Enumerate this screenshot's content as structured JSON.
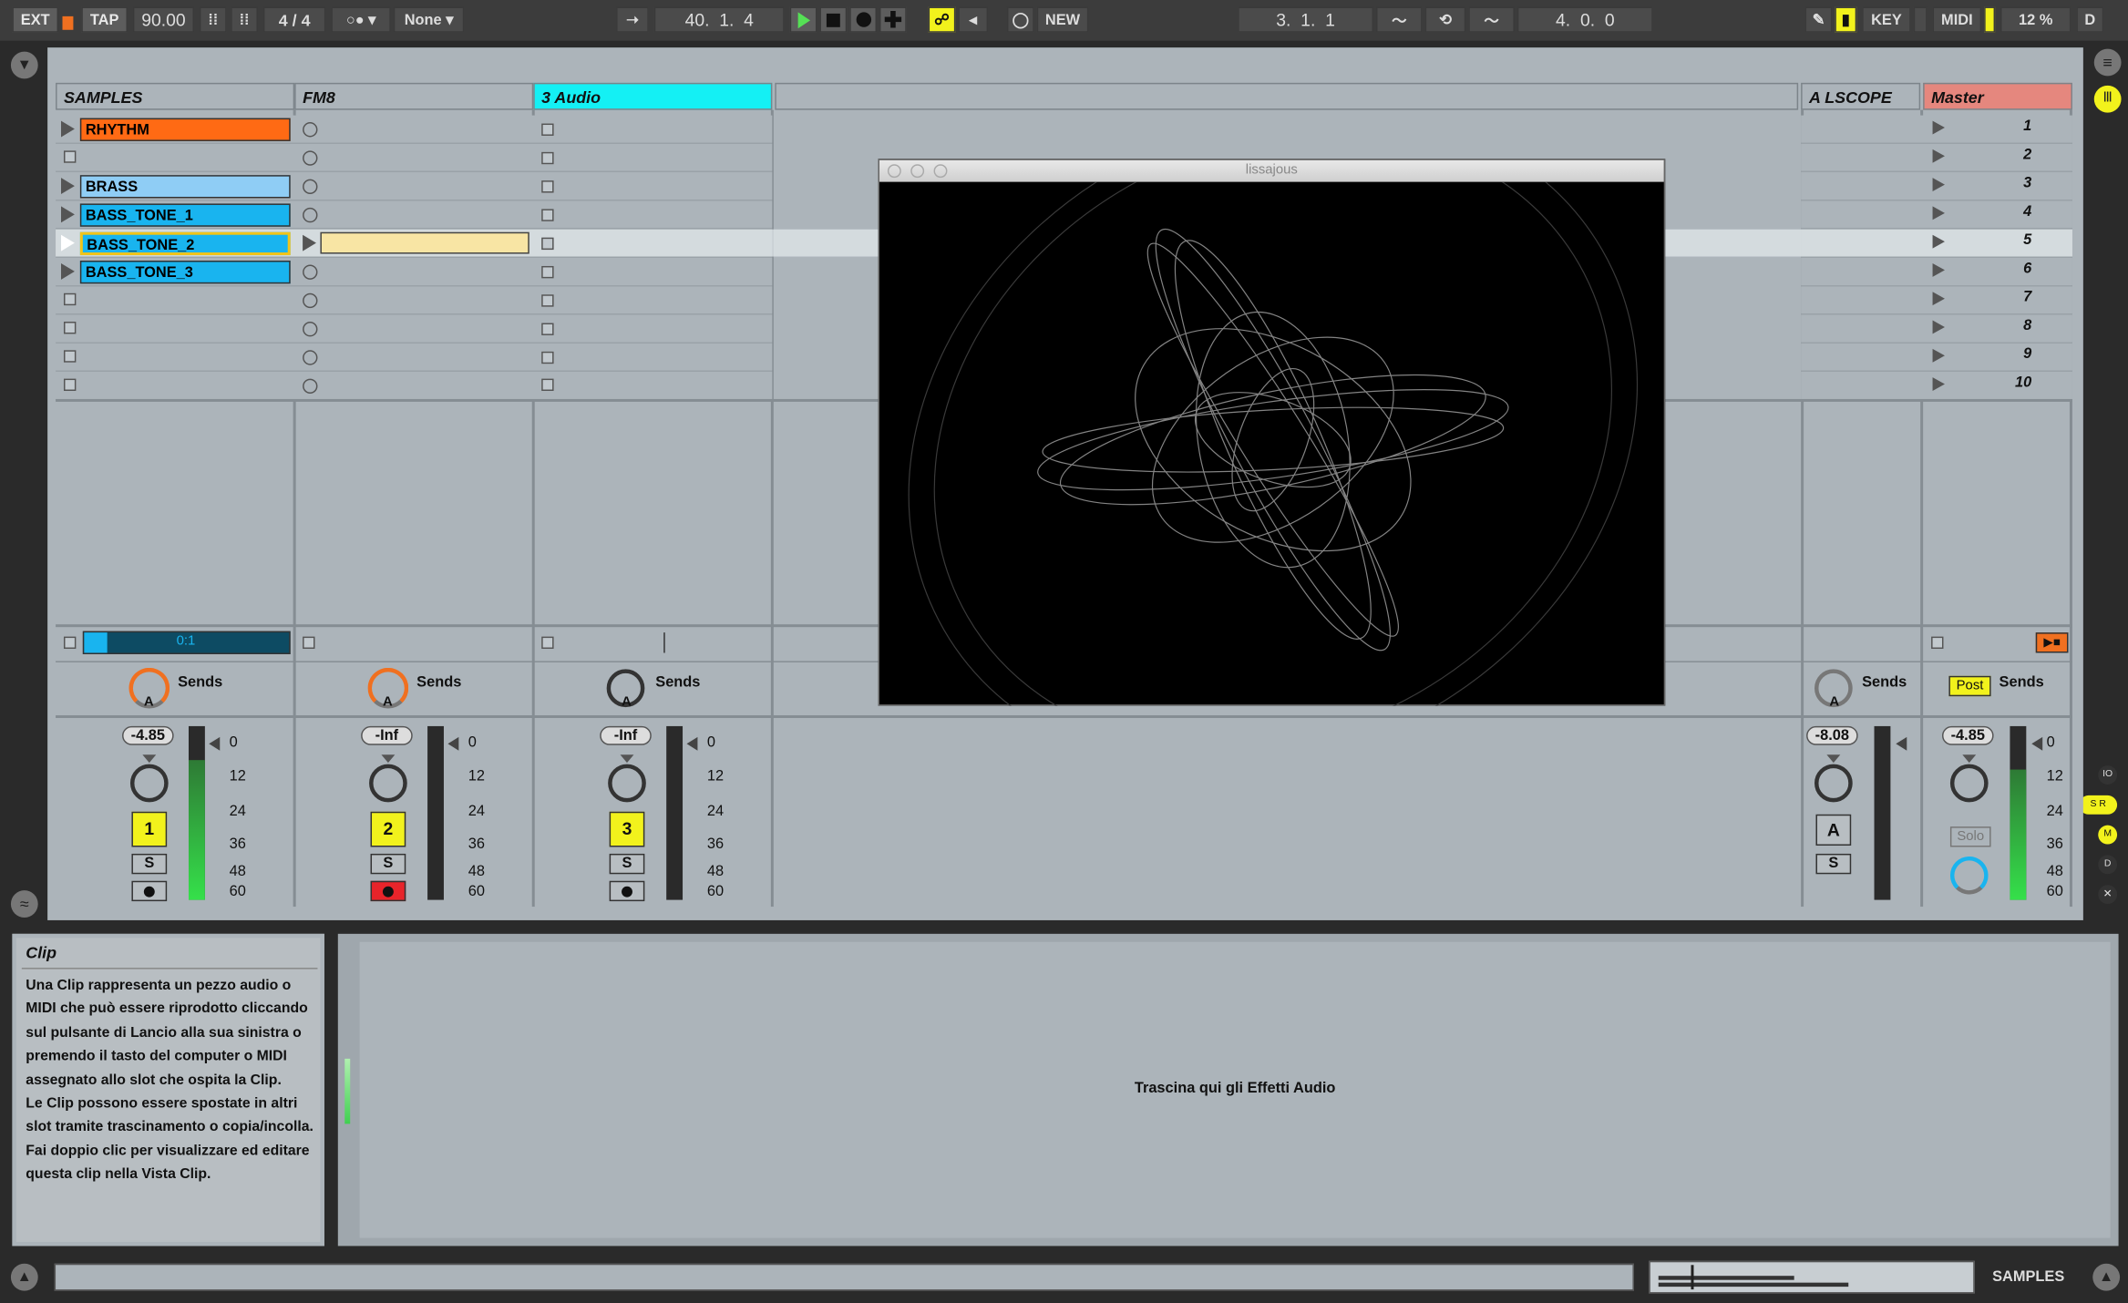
{
  "toolbar": {
    "ext": "EXT",
    "tap": "TAP",
    "bpm": "90.00",
    "meter_num": "4",
    "meter_den": "4",
    "quant": "None",
    "position": "40.  1.  4",
    "new": "NEW",
    "loop_start": "3.  1.  1",
    "loop_len": "4.  0.  0",
    "key": "KEY",
    "midi": "MIDI",
    "cpu": "12 %",
    "d": "D"
  },
  "tracks": [
    {
      "name": "SAMPLES",
      "color": "#acb4ba",
      "clips": [
        "RHYTHM",
        "",
        "BRASS",
        "BASS_TONE_1",
        "BASS_TONE_2",
        "BASS_TONE_3"
      ],
      "volume": "-4.85",
      "number": "1"
    },
    {
      "name": "FM8",
      "color": "#acb4ba",
      "volume": "-Inf",
      "number": "2"
    },
    {
      "name": "3 Audio",
      "color": "#14f0f4",
      "volume": "-Inf",
      "number": "3"
    }
  ],
  "return_track": {
    "name": "A LSCOPE",
    "volume": "-8.08",
    "letter": "A",
    "solo": "S"
  },
  "master": {
    "name": "Master",
    "scenes": [
      "1",
      "2",
      "3",
      "4",
      "5",
      "6",
      "7",
      "8",
      "9",
      "10"
    ],
    "volume": "-4.85",
    "post": "Post",
    "solo": "Solo"
  },
  "sends_label": "Sends",
  "solo_label": "S",
  "knob_letter": "A",
  "meter_scale": [
    "0",
    "12",
    "24",
    "36",
    "48",
    "60"
  ],
  "clip_progress": "0:1",
  "plugin_window": {
    "title": "lissajous"
  },
  "info": {
    "title": "Clip",
    "body": "Una Clip rappresenta un pezzo audio o MIDI che può essere riprodotto cliccando sul pulsante di Lancio alla sua sinistra o premendo il tasto del computer o MIDI assegnato allo slot che ospita la Clip.\nLe Clip possono essere spostate in altri slot tramite trascinamento o copia/incolla.\nFai doppio clic per visualizzare ed editare questa clip nella Vista Clip."
  },
  "device_drop": "Trascina qui gli Effetti Audio",
  "status": {
    "track_name": "SAMPLES"
  },
  "colors": {
    "rhythm": "#ff6a14",
    "brass": "#8fcdf5",
    "bass": "#19b4ef",
    "master": "#e5877e",
    "accent": "#f2f21c"
  }
}
